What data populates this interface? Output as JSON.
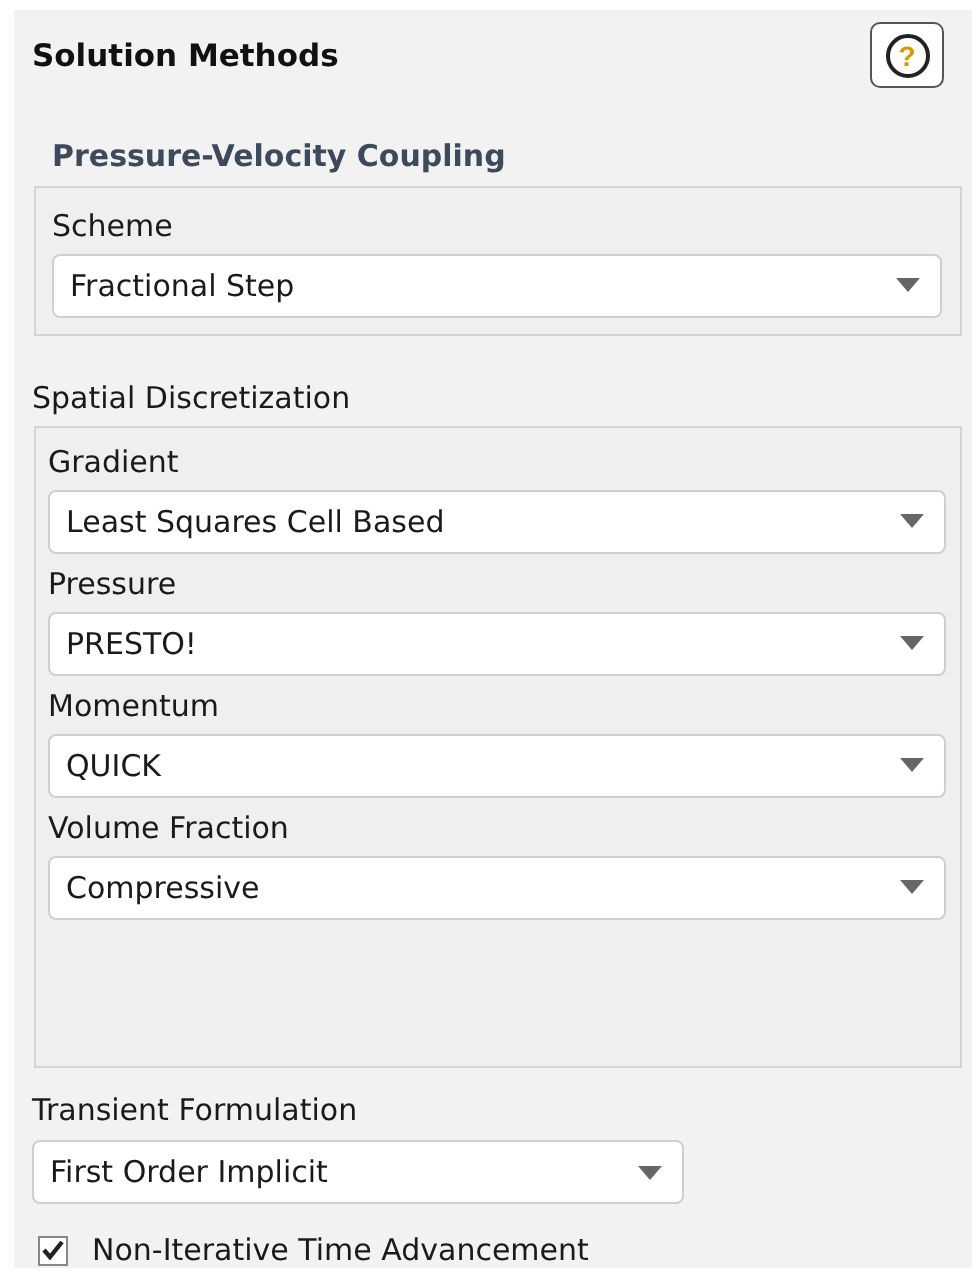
{
  "panel": {
    "title": "Solution Methods",
    "help_icon": "?"
  },
  "pressure_velocity_coupling": {
    "title": "Pressure-Velocity Coupling",
    "fields": [
      {
        "label": "Scheme",
        "value": "Fractional Step"
      }
    ]
  },
  "spatial_discretization": {
    "title": "Spatial Discretization",
    "fields": [
      {
        "label": "Gradient",
        "value": "Least Squares Cell Based"
      },
      {
        "label": "Pressure",
        "value": "PRESTO!"
      },
      {
        "label": "Momentum",
        "value": "QUICK"
      },
      {
        "label": "Volume Fraction",
        "value": "Compressive"
      }
    ]
  },
  "transient_formulation": {
    "label": "Transient Formulation",
    "value": "First Order Implicit"
  },
  "options": [
    {
      "label": "Non-Iterative Time Advancement",
      "checked": true
    }
  ]
}
